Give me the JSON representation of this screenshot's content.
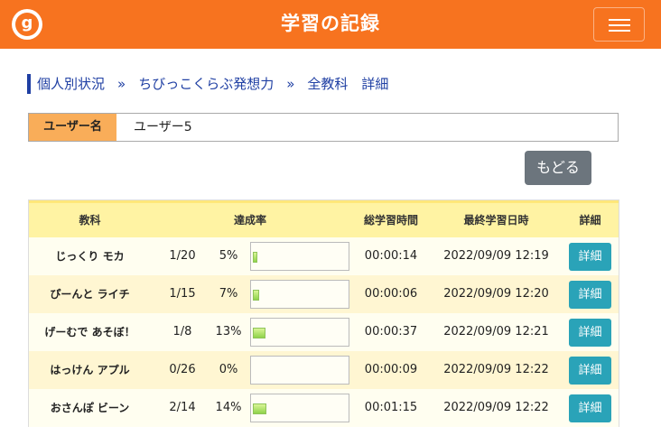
{
  "header": {
    "title": "学習の記録",
    "logo_icon": "g-logo-icon",
    "menu_icon": "hamburger-menu-icon",
    "color": "#f7731f"
  },
  "breadcrumb": {
    "items": [
      "個人別状況",
      "ちびっこくらぶ発想力",
      "全教科　詳細"
    ],
    "separator": "»"
  },
  "user": {
    "label": "ユーザー名",
    "value": "ユーザー5"
  },
  "back_button": {
    "label": "もどる"
  },
  "table": {
    "headers": {
      "subject": "教科",
      "rate": "達成率",
      "total_time": "総学習時間",
      "last_date": "最終学習日時",
      "detail": "詳細"
    },
    "rows": [
      {
        "subject": "じっくり モカ",
        "progress": "1/20",
        "percent": "5%",
        "rate": 5,
        "total_time": "00:00:14",
        "last_date": "2022/09/09 12:19",
        "detail": "詳細"
      },
      {
        "subject": "ぴーんと ライチ",
        "progress": "1/15",
        "percent": "7%",
        "rate": 7,
        "total_time": "00:00:06",
        "last_date": "2022/09/09 12:20",
        "detail": "詳細"
      },
      {
        "subject": "げーむで あそぼ！",
        "progress": "1/8",
        "percent": "13%",
        "rate": 13,
        "total_time": "00:00:37",
        "last_date": "2022/09/09 12:21",
        "detail": "詳細"
      },
      {
        "subject": "はっけん アプル",
        "progress": "0/26",
        "percent": "0%",
        "rate": 0,
        "total_time": "00:00:09",
        "last_date": "2022/09/09 12:22",
        "detail": "詳細"
      },
      {
        "subject": "おさんぽ ビーン",
        "progress": "2/14",
        "percent": "14%",
        "rate": 14,
        "total_time": "00:01:15",
        "last_date": "2022/09/09 12:22",
        "detail": "詳細"
      }
    ]
  }
}
